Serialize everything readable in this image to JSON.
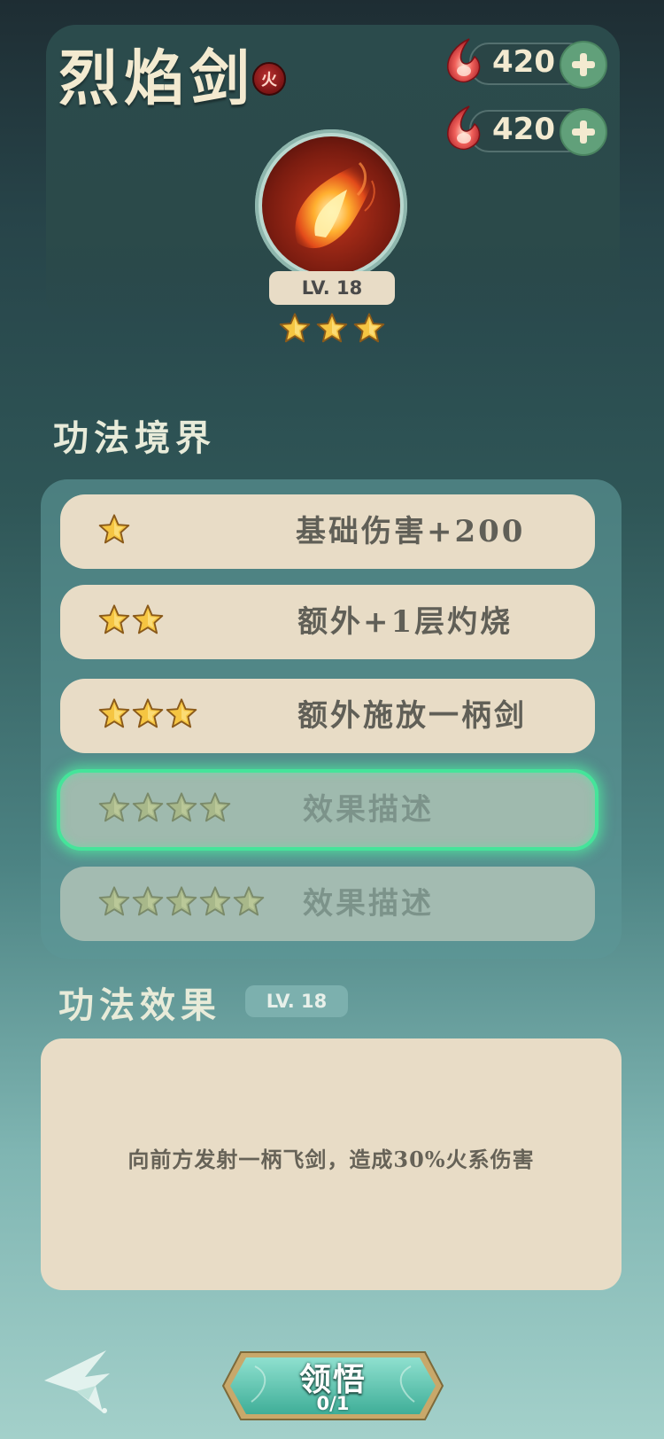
{
  "skill": {
    "name": "烈焰剑",
    "element_badge": "火",
    "level_label": "LV. 18",
    "stars": 3,
    "icon": "flame-sword-icon"
  },
  "currencies": [
    {
      "icon": "red-flame-icon",
      "value": "420"
    },
    {
      "icon": "red-flame-icon",
      "value": "420"
    }
  ],
  "realm": {
    "title": "功法境界",
    "rows": [
      {
        "stars": 1,
        "text": "基础伤害+200",
        "state": "unlocked"
      },
      {
        "stars": 2,
        "text": "额外+1层灼烧",
        "state": "unlocked"
      },
      {
        "stars": 3,
        "text": "额外施放一柄剑",
        "state": "unlocked"
      },
      {
        "stars": 4,
        "text": "效果描述",
        "state": "selected"
      },
      {
        "stars": 5,
        "text": "效果描述",
        "state": "locked"
      }
    ]
  },
  "effect": {
    "title": "功法效果",
    "level_label": "LV. 18",
    "description": "向前方发射一柄飞剑，造成30%火系伤害"
  },
  "actions": {
    "comprehend_label": "领悟",
    "comprehend_count": "0/1",
    "back_icon": "back-arrow-icon"
  },
  "colors": {
    "accent_green": "#45e49a",
    "panel_cream": "#e8dcc6",
    "star_gold": "#f5c542"
  }
}
